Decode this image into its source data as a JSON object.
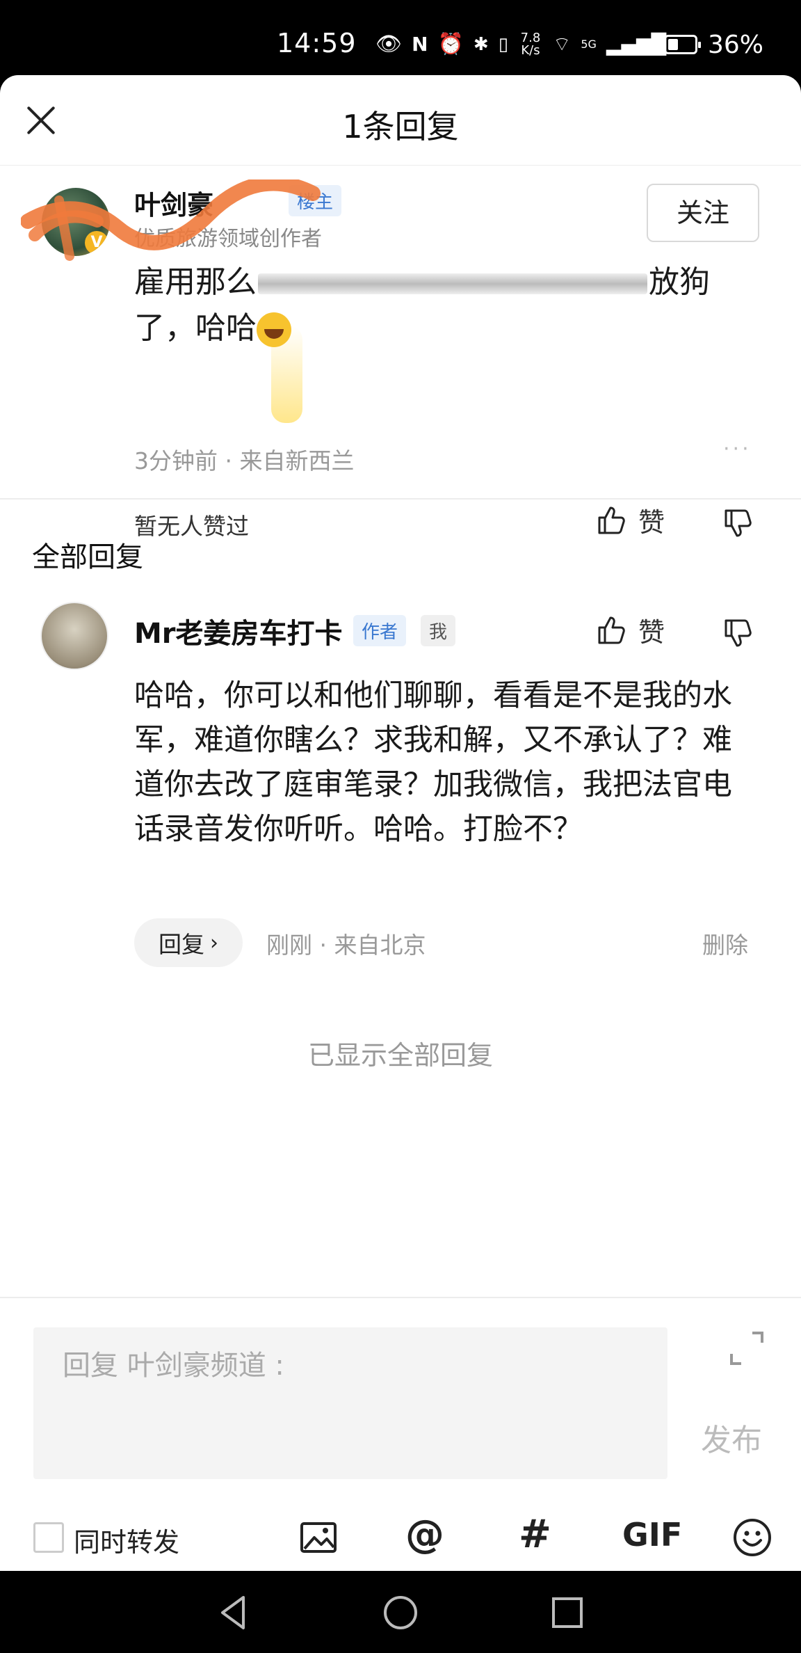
{
  "status_bar": {
    "time": "14:59",
    "net_speed": "7.8 K/s",
    "network": "5G",
    "battery_pct": "36%",
    "icons": [
      "eye-icon",
      "nfc-icon",
      "alarm-icon",
      "bluetooth-icon",
      "vibrate-icon",
      "wifi-icon",
      "signal-icon",
      "battery-icon"
    ]
  },
  "header": {
    "title": "1条回复",
    "close_icon": "close-icon"
  },
  "original_comment": {
    "author": "叶剑豪",
    "tag": "楼主",
    "subtitle": "优质旅游领域创作者",
    "follow_label": "关注",
    "text_start": "雇用那么",
    "text_end": "放狗",
    "text_line2": "了，哈哈",
    "time": "3分钟前",
    "location": "来自新西兰",
    "more": "···",
    "likes_text": "暂无人赞过",
    "like_label": "赞"
  },
  "section_title": "全部回复",
  "reply": {
    "author": "Mr老姜房车打卡",
    "tag_author": "作者",
    "tag_me": "我",
    "like_label": "赞",
    "text": "哈哈，你可以和他们聊聊，看看是不是我的水军，难道你瞎么？求我和解，又不承认了？难道你去改了庭审笔录？加我微信，我把法官电话录音发你听听。哈哈。打脸不？",
    "reply_btn": "回复",
    "time": "刚刚",
    "location": "来自北京",
    "delete_label": "删除"
  },
  "all_shown": "已显示全部回复",
  "composer": {
    "placeholder": "回复 叶剑豪频道 :",
    "publish_label": "发布",
    "repost_label": "同时转发",
    "gif_label": "GIF",
    "hash_label": "#",
    "at_label": "@",
    "accent_gray": "#bbbbbb"
  },
  "nav": {
    "back": "back-icon",
    "home": "home-icon",
    "recents": "recents-icon"
  }
}
